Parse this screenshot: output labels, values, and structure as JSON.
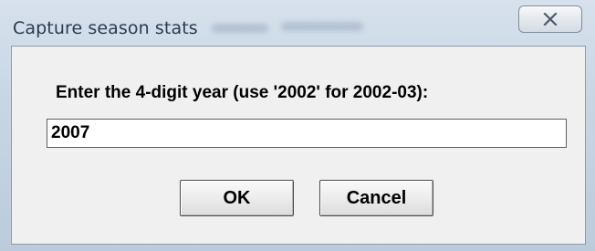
{
  "window": {
    "title": "Capture season stats",
    "close_icon": "close-x-icon"
  },
  "dialog": {
    "prompt": "Enter the 4-digit year (use '2002' for 2002-03):",
    "year_value": "2007",
    "ok_label": "OK",
    "cancel_label": "Cancel"
  }
}
